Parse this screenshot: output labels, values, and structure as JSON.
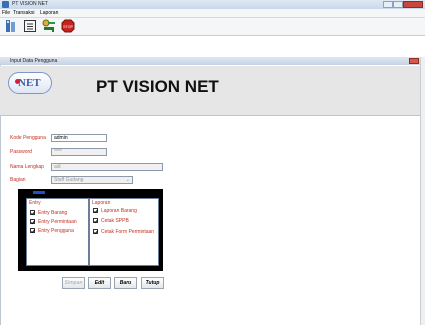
{
  "app": {
    "title": "PT VISION NET",
    "menu": [
      "File",
      "Transaksi",
      "Laporan"
    ],
    "toolbar_icons": [
      "users-icon",
      "document-icon",
      "keys-icon",
      "stop-icon"
    ]
  },
  "child_window": {
    "title": "Input Data Pengguna",
    "logo_text": "NET",
    "company": "PT VISION NET"
  },
  "form": {
    "kode_label": "Kode Pengguna",
    "kode_value": "admin",
    "password_label": "Password",
    "password_value": "****",
    "nama_label": "Nama Lengkap",
    "nama_value": "adi",
    "bagian_label": "Bagian",
    "bagian_value": "Staff Gudang"
  },
  "permissions": {
    "entry_title": "Entry",
    "entry_items": [
      "Entry Barang",
      "Entry Permintaan",
      "Entry Pengguna"
    ],
    "laporan_title": "Laporan",
    "laporan_items": [
      "Laporan Barang",
      "Cetak SPPB",
      "Cetak Form Permintaan"
    ]
  },
  "buttons": {
    "simpan": "Simpan",
    "edit": "Edit",
    "baru": "Baru",
    "tutup": "Tutup"
  },
  "colors": {
    "label_red": "#c03020",
    "header_gray": "#e6e6e6",
    "panel_black": "#000000"
  }
}
